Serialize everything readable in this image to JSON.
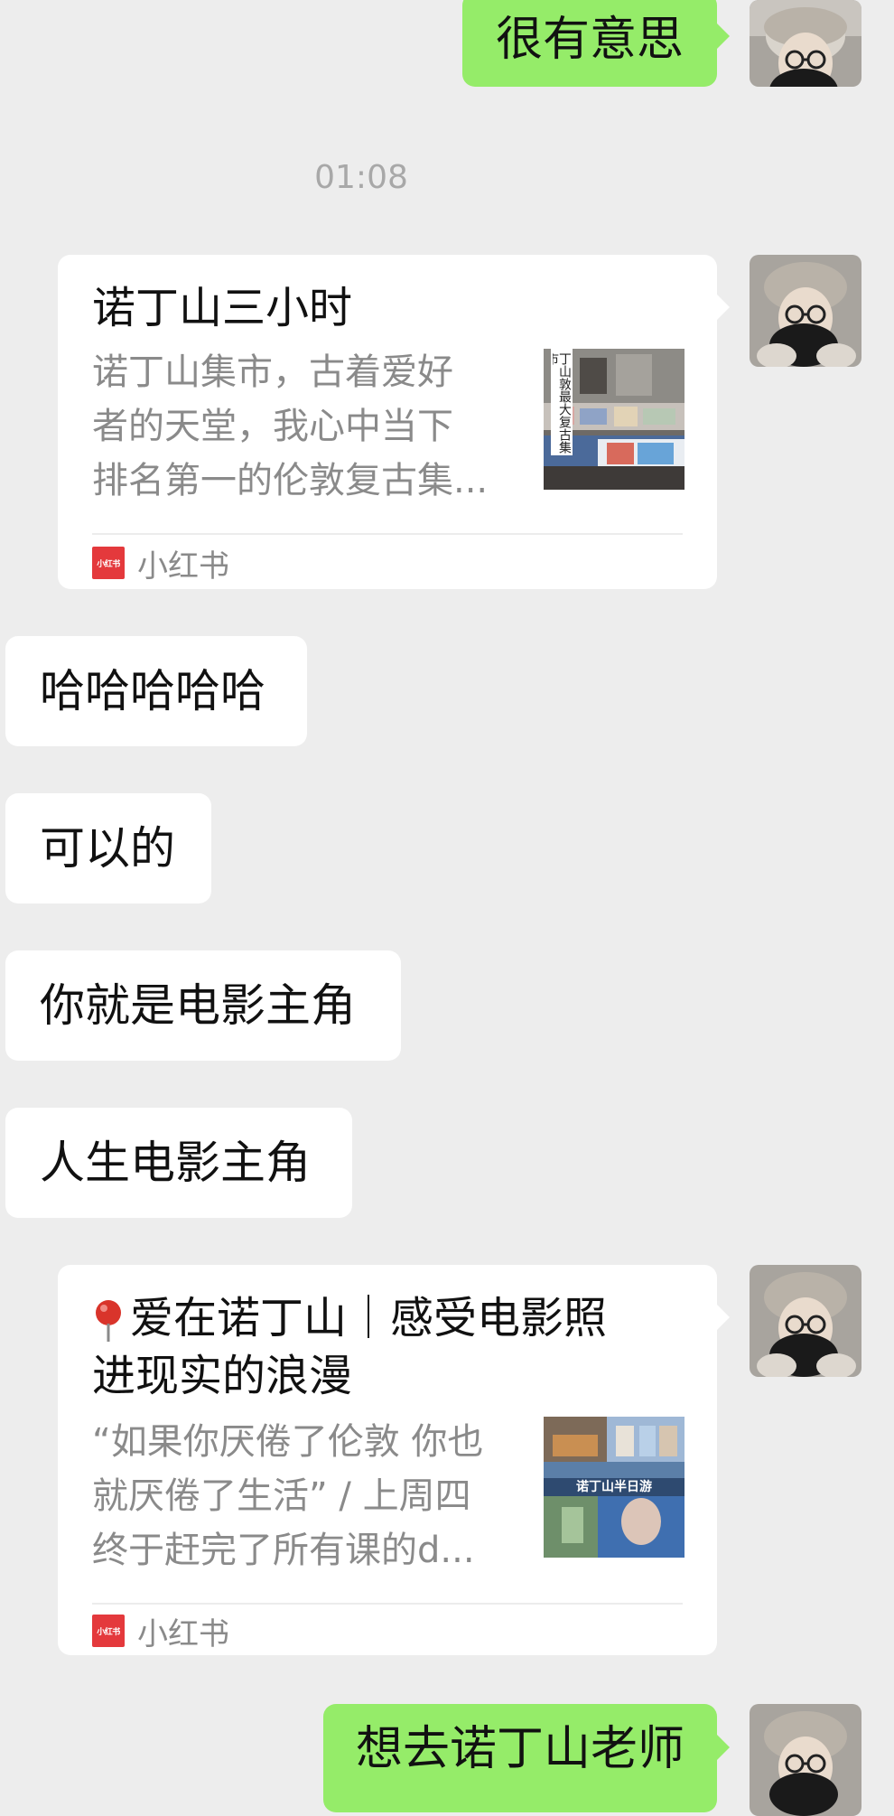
{
  "messages": {
    "m1": {
      "text": "很有意思"
    },
    "timestamp": "01:08",
    "card1": {
      "title": "诺丁山三小时",
      "desc_line1": "诺丁山集市，古着爱好",
      "desc_line2": "者的天堂，我心中当下",
      "desc_line3": "排名第一的伦敦复古集...",
      "thumb_caption": "丁山敦最大复古集市",
      "source_icon_text": "小红书",
      "source_label": "小红书"
    },
    "r1": {
      "text": "哈哈哈哈哈"
    },
    "r2": {
      "text": "可以的"
    },
    "r3": {
      "text": "你就是电影主角"
    },
    "r4": {
      "text": "人生电影主角"
    },
    "card2": {
      "title_line1": "爱在诺丁山｜感受电影照",
      "title_line2": "进现实的浪漫",
      "desc_line1": "“如果你厌倦了伦敦 你也",
      "desc_line2": "就厌倦了生活” / 上周四",
      "desc_line3": "终于赶完了所有课的d...",
      "thumb_caption": "诺丁山半日游",
      "source_icon_text": "小红书",
      "source_label": "小红书"
    },
    "m2": {
      "text": "想去诺丁山老师"
    }
  },
  "colors": {
    "background": "#ededed",
    "sent_bubble": "#95ec69",
    "received_bubble": "#ffffff",
    "timestamp": "#a8a8a8",
    "secondary_text": "#8a8a8a",
    "xiaohongshu_red": "#e4393c"
  },
  "icons": {
    "pin": "location-pin-icon",
    "source": "xiaohongshu-logo-icon"
  }
}
